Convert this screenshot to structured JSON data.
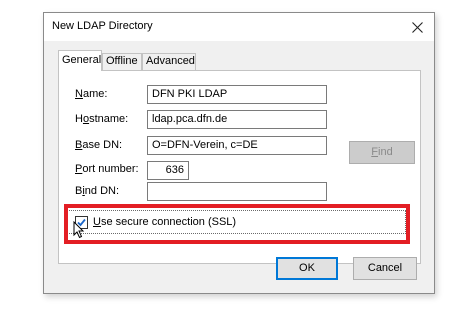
{
  "dialog": {
    "title": "New LDAP Directory",
    "tabs": [
      {
        "label": "General",
        "active": true
      },
      {
        "label": "Offline",
        "active": false
      },
      {
        "label": "Advanced",
        "active": false
      }
    ],
    "fields": {
      "name": {
        "label_prefix": "",
        "label_mnemonic": "N",
        "label_suffix": "ame:",
        "value": "DFN PKI LDAP"
      },
      "hostname": {
        "label_prefix": "H",
        "label_mnemonic": "o",
        "label_suffix": "stname:",
        "value": "ldap.pca.dfn.de"
      },
      "base_dn": {
        "label_prefix": "",
        "label_mnemonic": "B",
        "label_suffix": "ase DN:",
        "value": "O=DFN-Verein, c=DE"
      },
      "port_number": {
        "label_prefix": "",
        "label_mnemonic": "P",
        "label_suffix": "ort number:",
        "value": "636"
      },
      "bind_dn": {
        "label_prefix": "B",
        "label_mnemonic": "i",
        "label_suffix": "nd DN:",
        "value": ""
      }
    },
    "find_button": {
      "label_mnemonic": "F",
      "label_suffix": "ind",
      "enabled": false
    },
    "ssl": {
      "label_mnemonic": "U",
      "label_suffix": "se secure connection (SSL)",
      "checked": true
    },
    "ok_label": "OK",
    "cancel_label": "Cancel"
  },
  "colors": {
    "highlight": "#e31e24",
    "checkmark": "#1a66c9",
    "default_button_border": "#0078d7"
  },
  "icons": {
    "close": "close-icon",
    "cursor": "mouse-pointer-icon",
    "check": "checkmark-icon"
  }
}
